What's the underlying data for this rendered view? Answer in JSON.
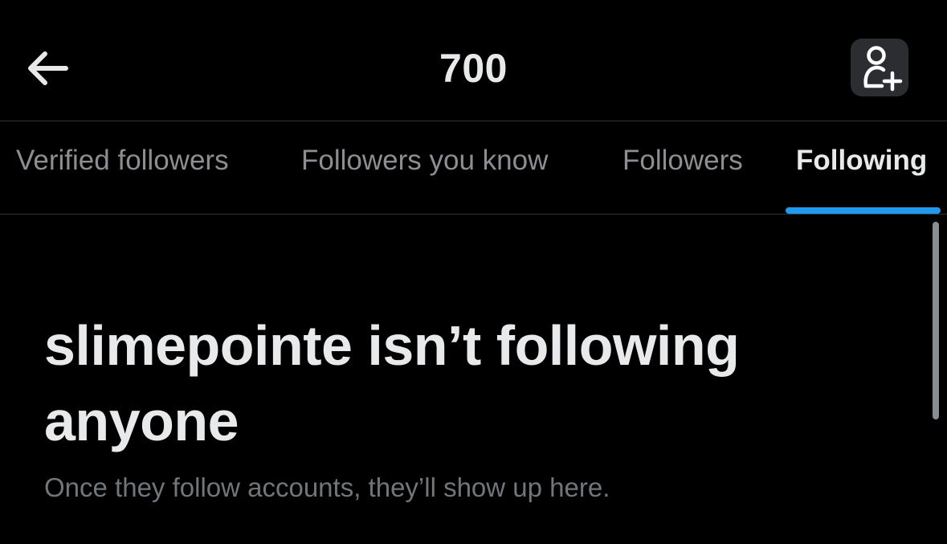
{
  "header": {
    "title": "700",
    "back_icon": "arrow-left-icon",
    "add_user_icon": "person-add-icon"
  },
  "tabs": [
    {
      "label": "Verified followers",
      "active": false
    },
    {
      "label": "Followers you know",
      "active": false
    },
    {
      "label": "Followers",
      "active": false
    },
    {
      "label": "Following",
      "active": true
    }
  ],
  "empty_state": {
    "title": "slimepointe isn’t following anyone",
    "subtitle": "Once they follow accounts, they’ll show up here."
  },
  "colors": {
    "background": "#000000",
    "primary_text": "#e7e9ea",
    "secondary_text": "#71767b",
    "accent": "#1d9bf0",
    "divider": "#2f3336"
  }
}
